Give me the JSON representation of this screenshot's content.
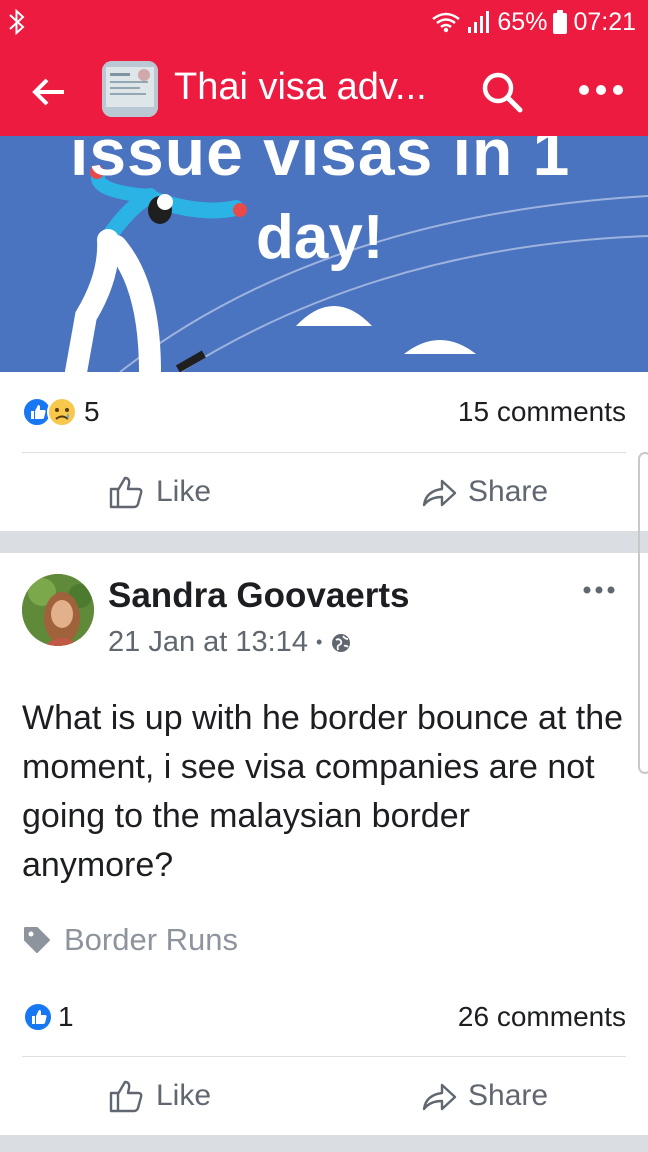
{
  "status_bar": {
    "battery_percent": "65%",
    "time": "07:21",
    "icons": [
      "bluetooth-icon",
      "wifi-icon",
      "signal-icon",
      "battery-icon"
    ]
  },
  "app_bar": {
    "title": "Thai visa adv...",
    "icons": [
      "back-arrow-icon",
      "search-icon",
      "more-icon"
    ]
  },
  "banner": {
    "line1": "issue visas in 1",
    "line2": "day!"
  },
  "post1_footer": {
    "reaction_count": "5",
    "comments": "15 comments",
    "like_label": "Like",
    "share_label": "Share"
  },
  "post2": {
    "author": "Sandra Goovaerts",
    "timestamp": "21 Jan at 13:14",
    "body": "What is up with he border bounce at the moment, i see visa companies are not going to the malaysian border anymore?",
    "topic": "Border Runs",
    "reaction_count": "1",
    "comments": "26 comments",
    "like_label": "Like",
    "share_label": "Share"
  },
  "colors": {
    "brand_bar": "#ed1b3f",
    "banner_bg": "#4a73c0",
    "like_blue": "#1877f2",
    "muted_text": "#606770"
  }
}
